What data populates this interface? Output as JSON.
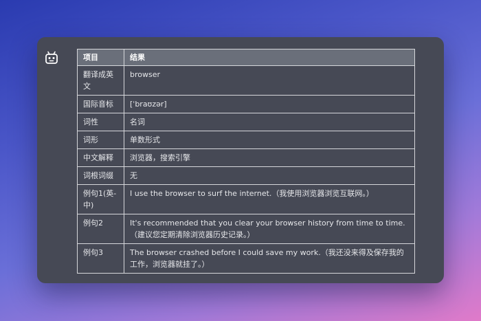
{
  "table": {
    "headers": [
      "项目",
      "结果"
    ],
    "rows": [
      [
        "翻译成英文",
        "browser"
      ],
      [
        "国际音标",
        "[ˈbraʊzər]"
      ],
      [
        "词性",
        "名词"
      ],
      [
        "词形",
        "单数形式"
      ],
      [
        "中文解释",
        "浏览器，搜索引擎"
      ],
      [
        "词根词缀",
        "无"
      ],
      [
        "例句1(英-中)",
        "I use the browser to surf the internet.（我使用浏览器浏览互联网。）"
      ],
      [
        "例句2",
        "It's recommended that you clear your browser history from time to time.（建议您定期清除浏览器历史记录。）"
      ],
      [
        "例句3",
        "The browser crashed before I could save my work.（我还没来得及保存我的工作，浏览器就挂了。）"
      ]
    ]
  },
  "icons": {
    "assistant": "robot-icon"
  },
  "colors": {
    "card_background": "#464955",
    "header_background": "#6a6f7a",
    "border": "#d7d8dc",
    "text": "#e6e7ea"
  }
}
